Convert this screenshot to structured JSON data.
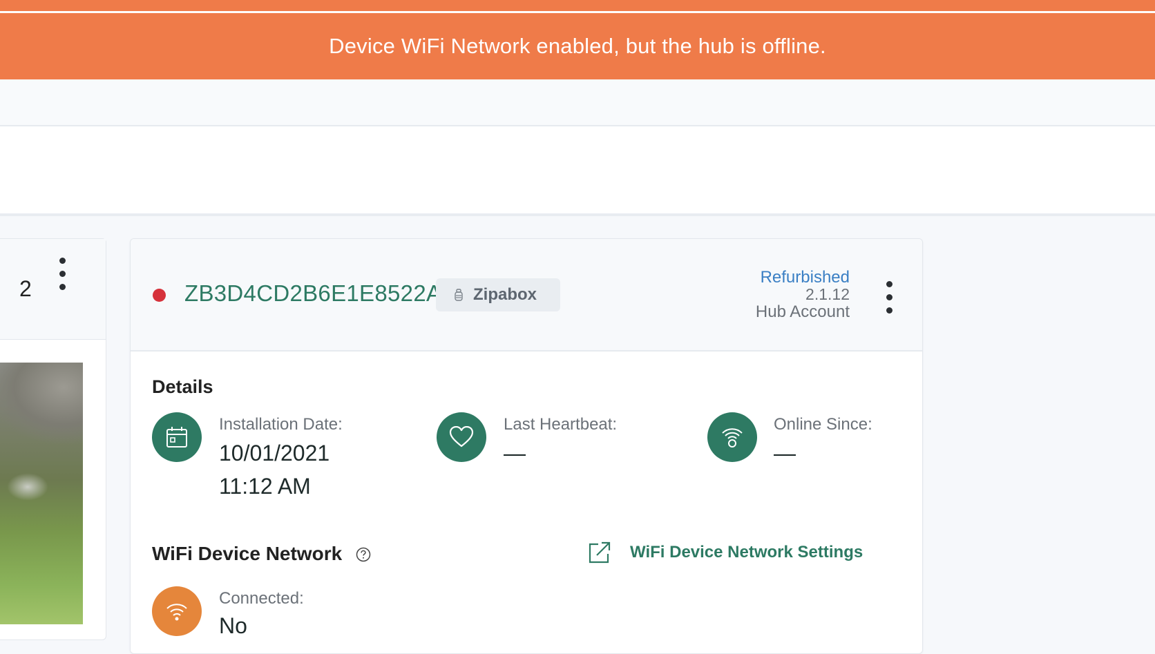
{
  "banner": {
    "message": "Device WiFi Network enabled, but the hub is offline."
  },
  "left_card": {
    "count": "2"
  },
  "hub": {
    "id": "ZB3D4CD2B6E1E8522A",
    "type_badge": "Zipabox",
    "condition": "Refurbished",
    "version": "2.1.12",
    "account": "Hub Account",
    "status_color": "#d6323b"
  },
  "details": {
    "title": "Details",
    "installation_date": {
      "label": "Installation Date:",
      "date": "10/01/2021",
      "time": "11:12 AM",
      "icon": "calendar-icon"
    },
    "last_heartbeat": {
      "label": "Last Heartbeat:",
      "value": "—",
      "icon": "heart-icon"
    },
    "online_since": {
      "label": "Online Since:",
      "value": "—",
      "icon": "wifi-signal-icon"
    }
  },
  "wifi_network": {
    "title": "WiFi Device Network",
    "settings_link": "WiFi Device Network Settings",
    "connected": {
      "label": "Connected:",
      "value": "No",
      "icon": "wifi-icon"
    }
  },
  "colors": {
    "banner": "#ef7b49",
    "accent_green": "#2e7a63",
    "link_blue": "#3a7fc4",
    "warning_orange": "#e5863b"
  }
}
